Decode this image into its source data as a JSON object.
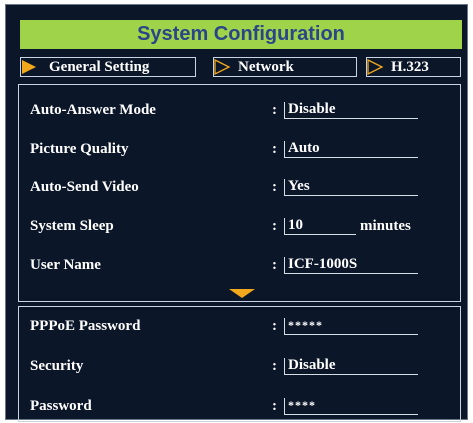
{
  "title": "System Configuration",
  "tabs": [
    {
      "label": "General Setting",
      "active": true
    },
    {
      "label": "Network",
      "active": false
    },
    {
      "label": "H.323",
      "active": false
    }
  ],
  "settings": [
    {
      "label": "Auto-Answer Mode",
      "value": "Disable"
    },
    {
      "label": "Picture Quality",
      "value": "Auto"
    },
    {
      "label": "Auto-Send Video",
      "value": "Yes"
    },
    {
      "label": "System Sleep",
      "value": "10",
      "suffix": "minutes"
    },
    {
      "label": "User Name",
      "value": "ICF-1000S"
    }
  ],
  "settings_more": [
    {
      "label": "PPPoE Password",
      "value": "*****"
    },
    {
      "label": "Security",
      "value": "Disable"
    },
    {
      "label": "Password",
      "value": "****"
    }
  ],
  "colon": ":",
  "colors": {
    "title_bar": "#9fd44a",
    "title_text": "#2a4688",
    "background": "#0b1629",
    "accent": "#f2a81d"
  }
}
